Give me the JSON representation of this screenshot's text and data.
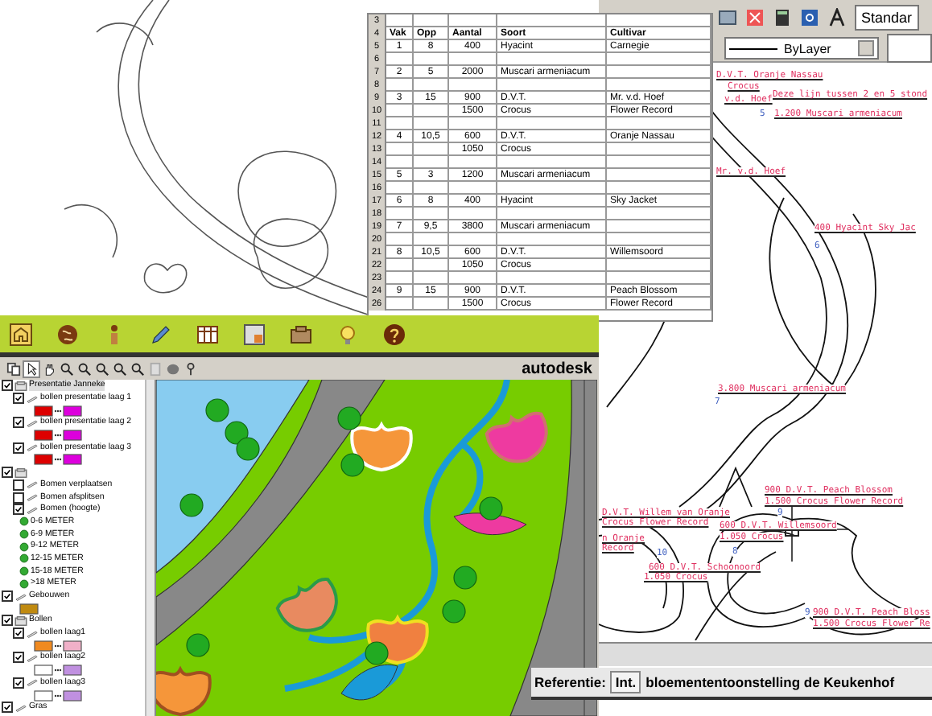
{
  "spreadsheet": {
    "top_rows": [
      {
        "num": "3"
      }
    ],
    "header_row": "4",
    "columns": [
      "Vak",
      "Opp",
      "Aantal",
      "Soort",
      "Cultivar"
    ],
    "rows": [
      {
        "num": "5",
        "vak": "1",
        "opp": "8",
        "aantal": "400",
        "soort": "Hyacint",
        "cultivar": "Carnegie"
      },
      {
        "num": "6"
      },
      {
        "num": "7",
        "vak": "2",
        "opp": "5",
        "aantal": "2000",
        "soort": "Muscari armeniacum"
      },
      {
        "num": "8"
      },
      {
        "num": "9",
        "vak": "3",
        "opp": "15",
        "aantal": "900",
        "soort": "D.V.T.",
        "cultivar": "Mr. v.d. Hoef"
      },
      {
        "num": "10",
        "aantal": "1500",
        "soort": "Crocus",
        "cultivar": "Flower Record"
      },
      {
        "num": "11"
      },
      {
        "num": "12",
        "vak": "4",
        "opp": "10,5",
        "aantal": "600",
        "soort": "D.V.T.",
        "cultivar": "Oranje Nassau"
      },
      {
        "num": "13",
        "aantal": "1050",
        "soort": "Crocus"
      },
      {
        "num": "14"
      },
      {
        "num": "15",
        "vak": "5",
        "opp": "3",
        "aantal": "1200",
        "soort": "Muscari armeniacum"
      },
      {
        "num": "16"
      },
      {
        "num": "17",
        "vak": "6",
        "opp": "8",
        "aantal": "400",
        "soort": "Hyacint",
        "cultivar": "Sky Jacket"
      },
      {
        "num": "18"
      },
      {
        "num": "19",
        "vak": "7",
        "opp": "9,5",
        "aantal": "3800",
        "soort": "Muscari armeniacum"
      },
      {
        "num": "20"
      },
      {
        "num": "21",
        "vak": "8",
        "opp": "10,5",
        "aantal": "600",
        "soort": "D.V.T.",
        "cultivar": "Willemsoord"
      },
      {
        "num": "22",
        "aantal": "1050",
        "soort": "Crocus"
      },
      {
        "num": "23"
      },
      {
        "num": "24",
        "vak": "9",
        "opp": "15",
        "aantal": "900",
        "soort": "D.V.T.",
        "cultivar": "Peach Blossom"
      },
      {
        "num": "26",
        "aantal": "1500",
        "soort": "Crocus",
        "cultivar": "Flower Record"
      }
    ]
  },
  "cad": {
    "style_dropdown": "Standar",
    "layer_dropdown": "ByLayer",
    "annotations": [
      {
        "kind": "label",
        "text": "D.V.T. Oranje Nassau"
      },
      {
        "kind": "label",
        "text": "Crocus"
      },
      {
        "kind": "label",
        "text": "v.d. Hoef"
      },
      {
        "kind": "label",
        "text": "Deze lijn tussen 2 en 5 stond"
      },
      {
        "kind": "number",
        "text": "5"
      },
      {
        "kind": "label",
        "text": "1.200 Muscari armeniacum"
      },
      {
        "kind": "label",
        "text": "Mr. v.d. Hoef"
      },
      {
        "kind": "label",
        "text": "400 Hyacint Sky Jac"
      },
      {
        "kind": "number",
        "text": "6"
      },
      {
        "kind": "label",
        "text": "3.800 Muscari armeniacum"
      },
      {
        "kind": "number",
        "text": "7"
      },
      {
        "kind": "label",
        "text": "900 D.V.T. Peach Blossom"
      },
      {
        "kind": "label",
        "text": "1.500 Crocus Flower Record"
      },
      {
        "kind": "number",
        "text": "9"
      },
      {
        "kind": "label",
        "text": "D.V.T. Willem van Oranje"
      },
      {
        "kind": "label",
        "text": "Crocus Flower Record"
      },
      {
        "kind": "label",
        "text": "n Oranje"
      },
      {
        "kind": "label",
        "text": "Record"
      },
      {
        "kind": "label",
        "text": "600 D.V.T. Willemsoord"
      },
      {
        "kind": "label",
        "text": "1.050 Crocus"
      },
      {
        "kind": "number",
        "text": "10"
      },
      {
        "kind": "number",
        "text": "8"
      },
      {
        "kind": "label",
        "text": "600 D.V.T. Schoonoord"
      },
      {
        "kind": "label",
        "text": "1.050 Crocus"
      },
      {
        "kind": "number",
        "text": "9"
      },
      {
        "kind": "label",
        "text": "900 D.V.T. Peach Bloss"
      },
      {
        "kind": "label",
        "text": "1.500 Crocus Flower Re"
      }
    ]
  },
  "reference": {
    "label": "Referentie:",
    "field": "Int.",
    "text": "bloemententoonstelling de Keukenhof"
  },
  "viewer": {
    "logo": "autodesk",
    "layers": [
      {
        "kind": "group",
        "label": "Presentatie Janneke",
        "checked": true,
        "children": [
          {
            "kind": "layer",
            "label": "bollen presentatie laag 1",
            "checked": true,
            "swatches": [
              {
                "color": "#dd0000"
              },
              {
                "color": "#dd00dd"
              }
            ]
          },
          {
            "kind": "layer",
            "label": "bollen presentatie laag 2",
            "checked": true,
            "swatches": [
              {
                "color": "#dd0000"
              },
              {
                "color": "#dd00dd"
              }
            ]
          },
          {
            "kind": "layer",
            "label": "bollen presentatie laag 3",
            "checked": true,
            "swatches": [
              {
                "color": "#dd0000"
              },
              {
                "color": "#dd00dd"
              }
            ]
          }
        ]
      },
      {
        "kind": "group",
        "checked": true,
        "children": [
          {
            "kind": "layer",
            "label": "Bomen verplaatsen",
            "checked": false
          },
          {
            "kind": "layer",
            "label": "Bomen afsplitsen",
            "checked": false
          },
          {
            "kind": "layer",
            "label": "Bomen (hoogte)",
            "checked": true
          },
          {
            "kind": "legend",
            "label": "0-6 METER"
          },
          {
            "kind": "legend",
            "label": "6-9 METER"
          },
          {
            "kind": "legend",
            "label": "9-12 METER"
          },
          {
            "kind": "legend",
            "label": "12-15 METER"
          },
          {
            "kind": "legend",
            "label": "15-18 METER"
          },
          {
            "kind": "legend",
            "label": ">18 METER"
          }
        ]
      },
      {
        "kind": "layer",
        "label": "Gebouwen",
        "checked": true,
        "swatches": [
          {
            "color": "#c08a10"
          }
        ]
      },
      {
        "kind": "group",
        "label": "Bollen",
        "checked": true,
        "children": [
          {
            "kind": "layer",
            "label": "bollen laag1",
            "checked": true,
            "swatches": [
              {
                "color": "#f08a20"
              },
              {
                "color": "#f0b0c8"
              }
            ]
          },
          {
            "kind": "layer",
            "label": "bollen laag2",
            "checked": true,
            "swatches": [
              {
                "color": "#ffffff"
              },
              {
                "color": "#c090e0"
              }
            ]
          },
          {
            "kind": "layer",
            "label": "bollen laag3",
            "checked": true,
            "swatches": [
              {
                "color": "#ffffff"
              },
              {
                "color": "#c090e0"
              }
            ]
          }
        ]
      },
      {
        "kind": "layer",
        "label": "Gras",
        "checked": true
      }
    ]
  }
}
